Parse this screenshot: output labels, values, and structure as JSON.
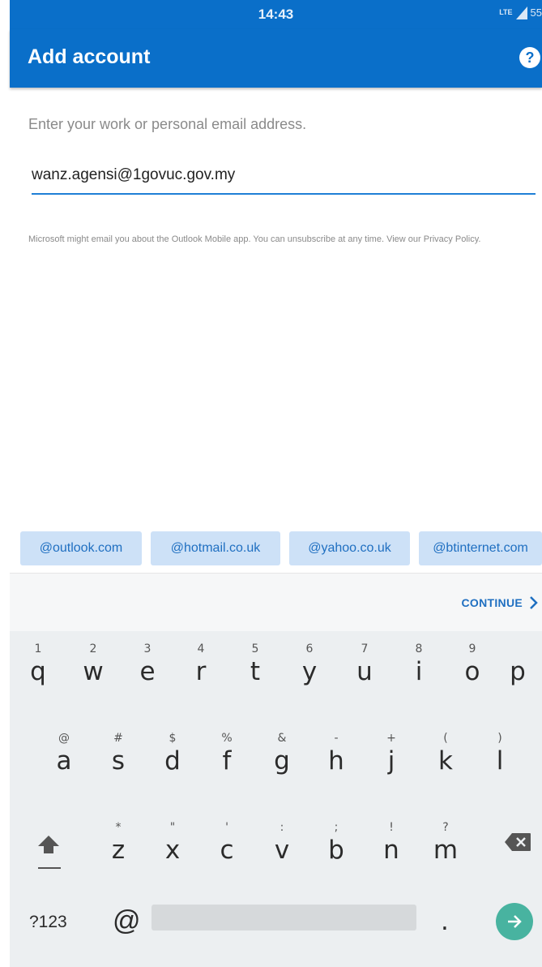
{
  "status_bar": {
    "time": "14:43",
    "network": "LTE",
    "battery": "55"
  },
  "app_bar": {
    "title": "Add account",
    "help_icon": "?"
  },
  "form": {
    "prompt": "Enter your work or personal email address.",
    "email_value": "wanz.agensi@1govuc.gov.my",
    "disclaimer": "Microsoft might email you about the Outlook Mobile app. You can unsubscribe at any time. View our Privacy Policy."
  },
  "suggestions": [
    "@outlook.com",
    "@hotmail.co.uk",
    "@yahoo.co.uk",
    "@btinternet.com"
  ],
  "continue_label": "CONTINUE",
  "keyboard": {
    "row1": [
      {
        "k": "q",
        "h": "1"
      },
      {
        "k": "w",
        "h": "2"
      },
      {
        "k": "e",
        "h": "3"
      },
      {
        "k": "r",
        "h": "4"
      },
      {
        "k": "t",
        "h": "5"
      },
      {
        "k": "y",
        "h": "6"
      },
      {
        "k": "u",
        "h": "7"
      },
      {
        "k": "i",
        "h": "8"
      },
      {
        "k": "o",
        "h": "9"
      },
      {
        "k": "p",
        "h": ""
      }
    ],
    "row2": [
      {
        "k": "a",
        "h": "@"
      },
      {
        "k": "s",
        "h": "#"
      },
      {
        "k": "d",
        "h": "$"
      },
      {
        "k": "f",
        "h": "%"
      },
      {
        "k": "g",
        "h": "&"
      },
      {
        "k": "h",
        "h": "-"
      },
      {
        "k": "j",
        "h": "+"
      },
      {
        "k": "k",
        "h": "("
      },
      {
        "k": "l",
        "h": ")"
      }
    ],
    "row3": [
      {
        "k": "z",
        "h": "*"
      },
      {
        "k": "x",
        "h": "\""
      },
      {
        "k": "c",
        "h": "'"
      },
      {
        "k": "v",
        "h": ":"
      },
      {
        "k": "b",
        "h": ";"
      },
      {
        "k": "n",
        "h": "!"
      },
      {
        "k": "m",
        "h": "?"
      }
    ],
    "symbols_label": "?123",
    "at_label": "@",
    "period_label": "."
  },
  "colors": {
    "accent": "#0a6fc9",
    "chip_bg": "#cde1f7",
    "enter": "#48b3a0"
  }
}
